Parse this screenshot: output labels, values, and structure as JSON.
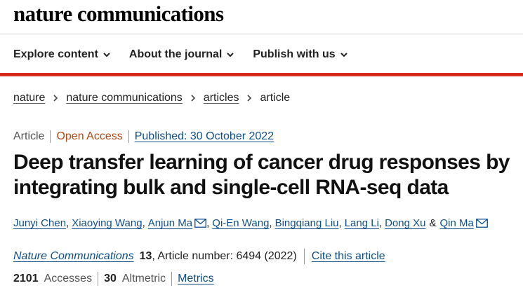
{
  "header": {
    "brand": "nature communications"
  },
  "nav": {
    "items": [
      {
        "label": "Explore content",
        "icon": "chevron-down-icon"
      },
      {
        "label": "About the journal",
        "icon": "chevron-down-icon"
      },
      {
        "label": "Publish with us",
        "icon": "chevron-down-icon"
      }
    ]
  },
  "colors": {
    "accent_bar": "#d72b20",
    "link": "#0f4e8a",
    "open_access": "#b24a17"
  },
  "breadcrumb": {
    "items": [
      "nature",
      "nature communications",
      "articles"
    ],
    "current": "article"
  },
  "article": {
    "type": "Article",
    "access": "Open Access",
    "published": "Published: 30 October 2022",
    "title": "Deep transfer learning of cancer drug responses by integrating bulk and single-cell RNA-seq data",
    "authors": [
      {
        "name": "Junyi Chen"
      },
      {
        "name": "Xiaoying Wang"
      },
      {
        "name": "Anjun Ma"
      },
      {
        "name": "Qi-En Wang"
      },
      {
        "name": "Bingqiang Liu"
      },
      {
        "name": "Lang Li"
      },
      {
        "name": "Dong Xu"
      },
      {
        "name": "Qin Ma"
      }
    ],
    "journal": "Nature Communications",
    "volume": "13",
    "article_number": ", Article number: 6494 (2022)",
    "cite_label": "Cite this article"
  },
  "metrics": {
    "accesses_value": "2101",
    "accesses_label": "Accesses",
    "altmetric_value": "30",
    "altmetric_label": "Altmetric",
    "metrics_link": "Metrics"
  }
}
